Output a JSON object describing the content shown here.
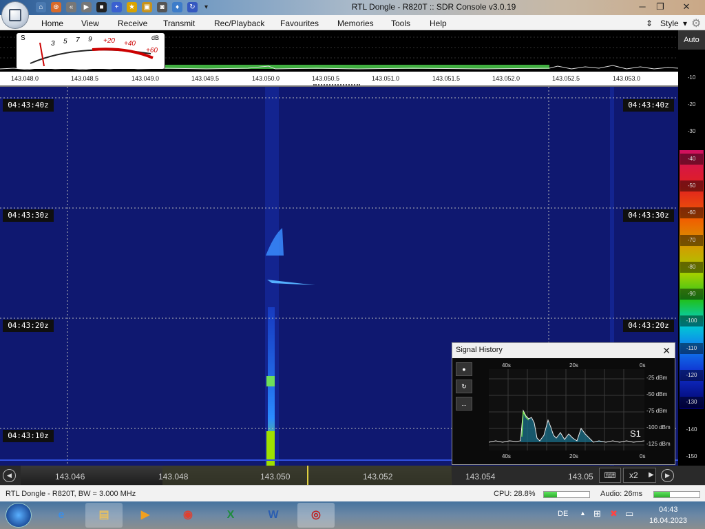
{
  "window": {
    "title": "RTL Dongle - R820T :: SDR Console v3.0.19"
  },
  "menu": {
    "items": [
      "Home",
      "View",
      "Receive",
      "Transmit",
      "Rec/Playback",
      "Favourites",
      "Memories",
      "Tools",
      "Help"
    ],
    "style_label": "Style"
  },
  "smeter": {
    "s_label": "S",
    "db_label": "dB",
    "s_ticks": [
      "3",
      "5",
      "7",
      "9"
    ],
    "db_ticks": [
      "+20",
      "+40",
      "+60"
    ]
  },
  "frequency_scale": {
    "labels": [
      "143.048.0",
      "143.048.5",
      "143.049.0",
      "143.049.5",
      "143.050.0",
      "143.050.5",
      "143.051.0",
      "143.051.5",
      "143.052.0",
      "143.052.5",
      "143.053.0"
    ]
  },
  "waterfall": {
    "timestamps": [
      "04:43:40z",
      "04:43:30z",
      "04:43:20z",
      "04:43:10z"
    ]
  },
  "db_scale": {
    "auto_label": "Auto",
    "labels": [
      "-10",
      "-20",
      "-30",
      "-40",
      "-50",
      "-60",
      "-70",
      "-80",
      "-90",
      "-100",
      "-110",
      "-120",
      "-130",
      "-140",
      "-150"
    ]
  },
  "signal_history": {
    "title": "Signal History",
    "time_top": [
      "40s",
      "20s",
      "0s"
    ],
    "time_bottom": [
      "40s",
      "20s",
      "0s"
    ],
    "dbm_labels": [
      "-25 dBm",
      "-50 dBm",
      "-75 dBm",
      "-100 dBm",
      "-125 dBm"
    ],
    "s_indicator": "S1",
    "buttons": [
      "●",
      "↻",
      "..."
    ]
  },
  "tuning": {
    "labels": [
      "143.046",
      "143.048",
      "143.050",
      "143.052",
      "143.054",
      "143.05"
    ],
    "zoom": "x2"
  },
  "status": {
    "device": "RTL Dongle - R820T, BW = 3.000 MHz",
    "cpu": "CPU: 28.8%",
    "cpu_fraction": 0.288,
    "audio": "Audio: 26ms"
  },
  "taskbar": {
    "lang": "DE",
    "time": "04:43",
    "date": "16.04.2023"
  }
}
